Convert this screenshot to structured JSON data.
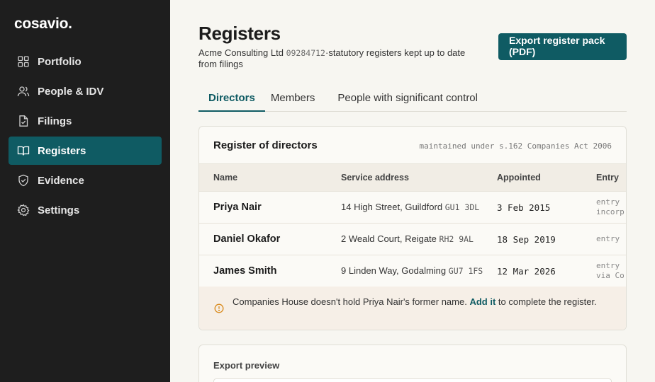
{
  "app": {
    "logo": "cosavio."
  },
  "sidebar": {
    "items": [
      {
        "label": "Portfolio",
        "icon": "grid-icon"
      },
      {
        "label": "People & IDV",
        "icon": "users-icon"
      },
      {
        "label": "Filings",
        "icon": "file-check-icon"
      },
      {
        "label": "Registers",
        "icon": "book-open-icon",
        "active": true
      },
      {
        "label": "Evidence",
        "icon": "shield-check-icon"
      },
      {
        "label": "Settings",
        "icon": "gear-icon"
      }
    ]
  },
  "header": {
    "title": "Registers",
    "company": "Acme Consulting Ltd",
    "company_number": "09284712",
    "separator": "·",
    "subtitle_rest": "statutory registers kept up to date from filings",
    "export_label": "Export register pack (PDF)"
  },
  "tabs": [
    {
      "label": "Directors",
      "active": true
    },
    {
      "label": "Members"
    },
    {
      "label": "People with significant control"
    }
  ],
  "register": {
    "title": "Register of directors",
    "note": "maintained under s.162 Companies Act 2006",
    "columns": [
      "Name",
      "Service address",
      "Appointed",
      "Entry"
    ],
    "rows": [
      {
        "name": "Priya Nair",
        "address": "14 High Street, Guildford",
        "postcode": "GU1 3DL",
        "appointed": "3 Feb 2015",
        "entry_1": "entry",
        "entry_2": "incorp"
      },
      {
        "name": "Daniel Okafor",
        "address": "2 Weald Court, Reigate",
        "postcode": "RH2 9AL",
        "appointed": "18 Sep 2019",
        "entry_1": "entry",
        "entry_2": ""
      },
      {
        "name": "James Smith",
        "address": "9 Linden Way, Godalming",
        "postcode": "GU7 1FS",
        "appointed": "12 Mar 2026",
        "entry_1": "entry",
        "entry_2": "via Co"
      }
    ],
    "notice": {
      "before": "Companies House doesn't hold Priya Nair's former name.",
      "link": "Add it",
      "after": "to complete the register."
    }
  },
  "export_preview": {
    "title": "Export preview"
  },
  "colors": {
    "accent": "#0f5b63",
    "sidebar": "#1e1e1e",
    "warning": "#d98a1c"
  }
}
